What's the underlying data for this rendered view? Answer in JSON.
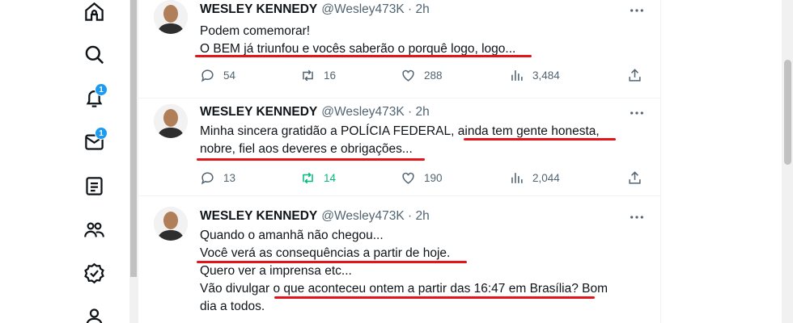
{
  "nav": {
    "items": [
      {
        "icon": "home-icon"
      },
      {
        "icon": "search-icon"
      },
      {
        "icon": "bell-icon",
        "badge": "1"
      },
      {
        "icon": "mail-icon",
        "badge": "1"
      },
      {
        "icon": "lists-icon"
      },
      {
        "icon": "communities-icon"
      },
      {
        "icon": "verified-icon"
      },
      {
        "icon": "profile-icon"
      }
    ]
  },
  "tweets": [
    {
      "author": "WESLEY KENNEDY",
      "handle": "@Wesley473K · 2h",
      "lines": [
        "Podem comemorar!",
        "O BEM já triunfou e vocês saberão o porquê logo, logo..."
      ],
      "replies": "54",
      "retweets": "16",
      "likes": "288",
      "views": "3,484",
      "retweeted": false
    },
    {
      "author": "WESLEY KENNEDY",
      "handle": "@Wesley473K · 2h",
      "lines": [
        "Minha sincera gratidão a POLÍCIA FEDERAL, ainda tem gente honesta,",
        "nobre, fiel aos deveres e obrigações..."
      ],
      "replies": "13",
      "retweets": "14",
      "likes": "190",
      "views": "2,044",
      "retweeted": true
    },
    {
      "author": "WESLEY KENNEDY",
      "handle": "@Wesley473K · 2h",
      "lines": [
        "Quando o amanhã não chegou...",
        "Você verá as consequências a partir de hoje.",
        "Quero ver a imprensa etc...",
        "Vão divulgar o que aconteceu ontem a partir das 16:47 em Brasília? Bom",
        "dia a todos."
      ]
    }
  ],
  "colors": {
    "accent": "#1d9bf0",
    "underline": "#e3151a",
    "retweet_active": "#00ba7c",
    "muted": "#536471"
  }
}
